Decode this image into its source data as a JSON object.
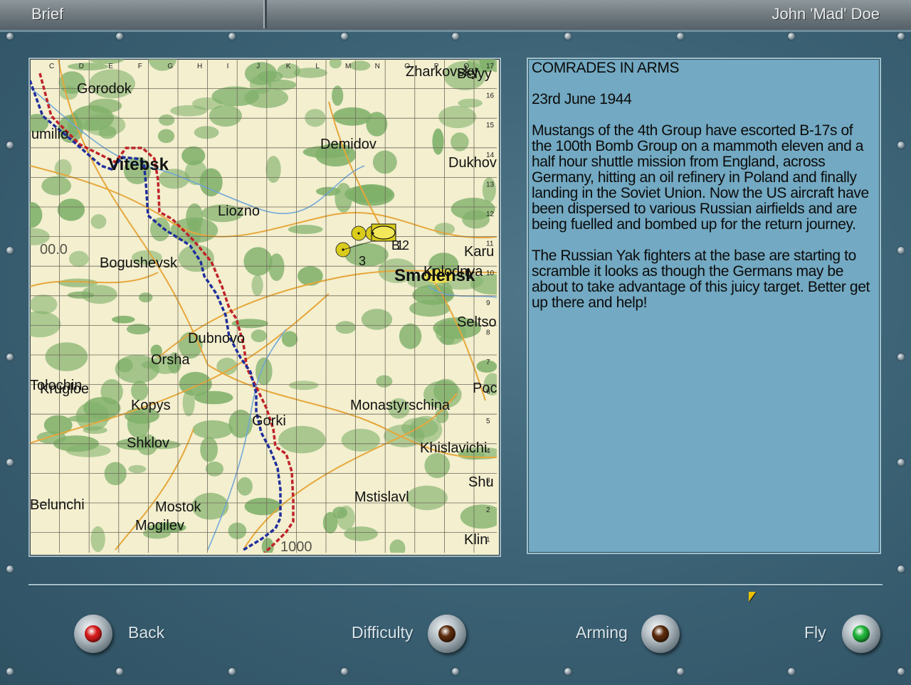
{
  "window": {
    "title_left": "Brief",
    "title_right": "John 'Mad' Doe"
  },
  "map": {
    "column_letters": [
      "C",
      "D",
      "E",
      "F",
      "G",
      "H",
      "I",
      "J",
      "K",
      "L",
      "M",
      "N",
      "O",
      "P",
      "Q"
    ],
    "row_numbers": [
      "17",
      "16",
      "15",
      "14",
      "13",
      "12",
      "11",
      "10",
      "9",
      "8",
      "7",
      "6",
      "5",
      "4",
      "3",
      "2",
      "1"
    ],
    "places": {
      "gorodok": "Gorodok",
      "surazh": "umilio",
      "vitebsk": "Vitebsk",
      "demidov": "Demidov",
      "dukhov": "Dukhov",
      "zharkovsky": "Zharkovsky",
      "belyy": "Belyy",
      "liozno": "Liozno",
      "kard": "Karu",
      "bogushevsk": "Bogushevsk",
      "smolensk": "Smolensk",
      "kolodnya": "Kolodnya",
      "seltso": "Seltso",
      "dubnovo": "Dubnovo",
      "orsha": "Orsha",
      "tolochin": "Tolochin",
      "krugloe": "Krugloe",
      "kopys": "Kopys",
      "monastyrschina": "Monastyrschina",
      "pochinok": "Poc",
      "gorki": "Gorki",
      "shklov": "Shklov",
      "khislavichi": "Khislavichi",
      "shumyachi": "Shu",
      "mstislavl": "Mstislavl",
      "belunchi": "Belunchi",
      "mostok": "Mostok",
      "mogilev": "Mogilev",
      "klin": "Klin",
      "alt_1": "00.0",
      "alt_2": "1000"
    },
    "markers": {
      "flight_1": "1",
      "flight_2": "2",
      "flight_3": "3",
      "flight_label_b": "B"
    },
    "colors": {
      "front_line_red": "#c0232a",
      "front_line_blue": "#1f2e9c",
      "forest": "#7fb06a",
      "road": "#e7a73a",
      "water": "#6ea6d8",
      "marker": "#d9cc1a"
    }
  },
  "briefing": {
    "heading": "COMRADES IN ARMS",
    "date": "23rd June 1944",
    "paragraph_1": "Mustangs of the 4th Group have escorted B-17s of the 100th Bomb Group on a mammoth eleven and a half hour shuttle mission from England, across Germany, hitting an oil refinery in Poland and finally landing in the Soviet Union. Now the US aircraft have been dispersed to various Russian airfields and are being fuelled and bombed up for the return journey.",
    "paragraph_2": "The Russian Yak fighters at the base are starting to scramble it looks as though the Germans may be about to take advantage of this juicy target. Better get up there and help!"
  },
  "controls": {
    "back_label": "Back",
    "difficulty_label": "Difficulty",
    "arming_label": "Arming",
    "fly_label": "Fly",
    "back_lamp_color": "#d41a1a",
    "difficulty_lamp_color": "#5a2a0c",
    "arming_lamp_color": "#5a2a0c",
    "fly_lamp_color": "#1fb33a"
  }
}
